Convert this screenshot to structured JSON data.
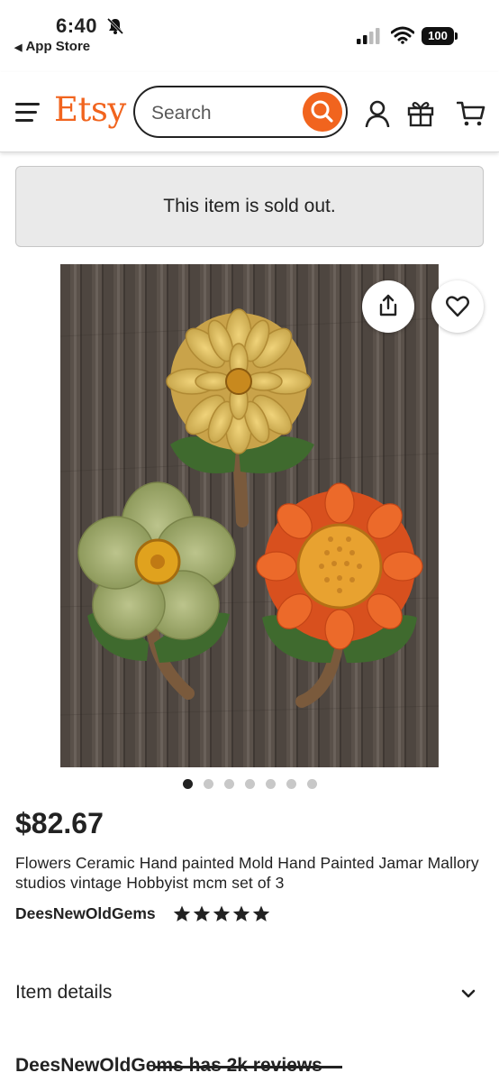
{
  "status_bar": {
    "time": "6:40",
    "back_label": "App Store",
    "battery": "100"
  },
  "header": {
    "logo": "Etsy",
    "search_placeholder": "Search"
  },
  "notice": {
    "sold_out": "This item is sold out."
  },
  "carousel": {
    "count": 7,
    "active_index": 0
  },
  "listing": {
    "price": "$82.67",
    "title": "Flowers Ceramic Hand painted Mold Hand Painted Jamar Mallory studios vintage Hobbyist mcm set of 3",
    "shop_name": "DeesNewOldGems",
    "rating_stars": 5
  },
  "sections": {
    "item_details": "Item details",
    "reviews_heading": "DeesNewOldGems has 2k reviews"
  },
  "colors": {
    "brand": "#f1641e"
  }
}
